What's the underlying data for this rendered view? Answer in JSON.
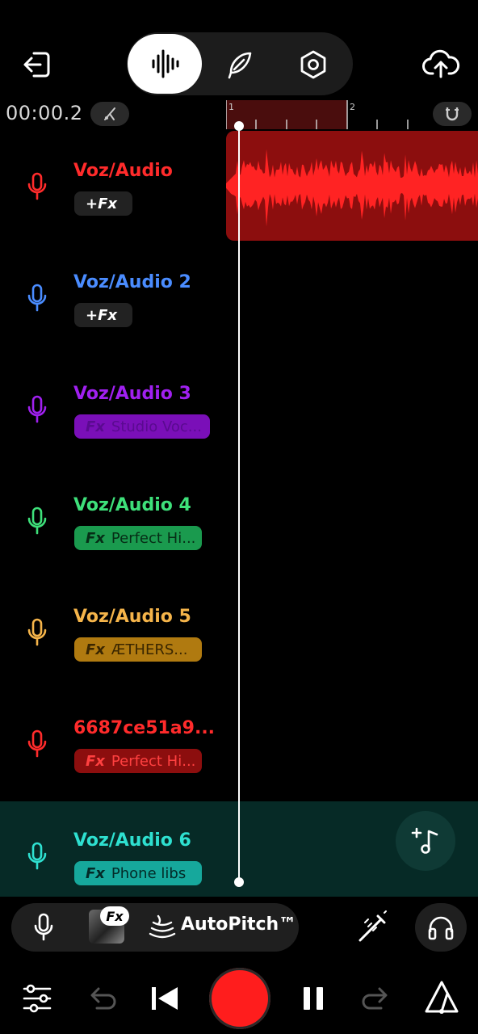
{
  "header": {
    "time": "00:00.2",
    "ruler_marks": [
      "1",
      "2"
    ]
  },
  "tracks": [
    {
      "name": "Voz/Audio",
      "color": "#ff2b2b",
      "fx_label": "Fx",
      "fx_text": "",
      "fx_plus": "+",
      "fx_bg": "#222222",
      "fx_fg": "#ffffff"
    },
    {
      "name": "Voz/Audio 2",
      "color": "#4a8cff",
      "fx_label": "Fx",
      "fx_text": "",
      "fx_plus": "+",
      "fx_bg": "#222222",
      "fx_fg": "#ffffff"
    },
    {
      "name": "Voz/Audio 3",
      "color": "#a020f0",
      "fx_label": "Fx",
      "fx_text": "Studio Voc...",
      "fx_bg": "#7a0fb8",
      "fx_fg": "#5a0a90"
    },
    {
      "name": "Voz/Audio 4",
      "color": "#3ee07a",
      "fx_label": "Fx",
      "fx_text": "Perfect Hi...",
      "fx_bg": "#1a9a4e",
      "fx_fg": "#062d16"
    },
    {
      "name": "Voz/Audio 5",
      "color": "#f5b44a",
      "fx_label": "Fx",
      "fx_text": "ÆTHERS...",
      "fx_bg": "#b07a10",
      "fx_fg": "#3a2600"
    },
    {
      "name": "6687ce51a9...",
      "color": "#ff2b2b",
      "fx_label": "Fx",
      "fx_text": "Perfect Hi...",
      "fx_bg": "#8c0e0e",
      "fx_fg": "#ff4040"
    },
    {
      "name": "Voz/Audio 6",
      "color": "#2ee0d0",
      "fx_label": "Fx",
      "fx_text": "Phone libs",
      "fx_bg": "#16a89c",
      "fx_fg": "#032a27"
    }
  ],
  "toolbar": {
    "fx_badge": "Fx",
    "autopitch_label": "AutoPitch™"
  },
  "colors": {
    "accent_red": "#ff1d1d",
    "clip_red": "#8c0e0e",
    "selected_band": "#062a26"
  },
  "icons": [
    "back-icon",
    "waveform-icon",
    "feather-icon",
    "hex-settings-icon",
    "cloud-upload-icon",
    "metronome-icon",
    "magnet-icon",
    "mic-icon",
    "add-track-icon",
    "autopitch-icon",
    "magic-wand-icon",
    "headphones-icon",
    "mixer-icon",
    "undo-icon",
    "skip-back-icon",
    "record-icon",
    "pause-icon",
    "redo-icon",
    "tuner-icon"
  ]
}
